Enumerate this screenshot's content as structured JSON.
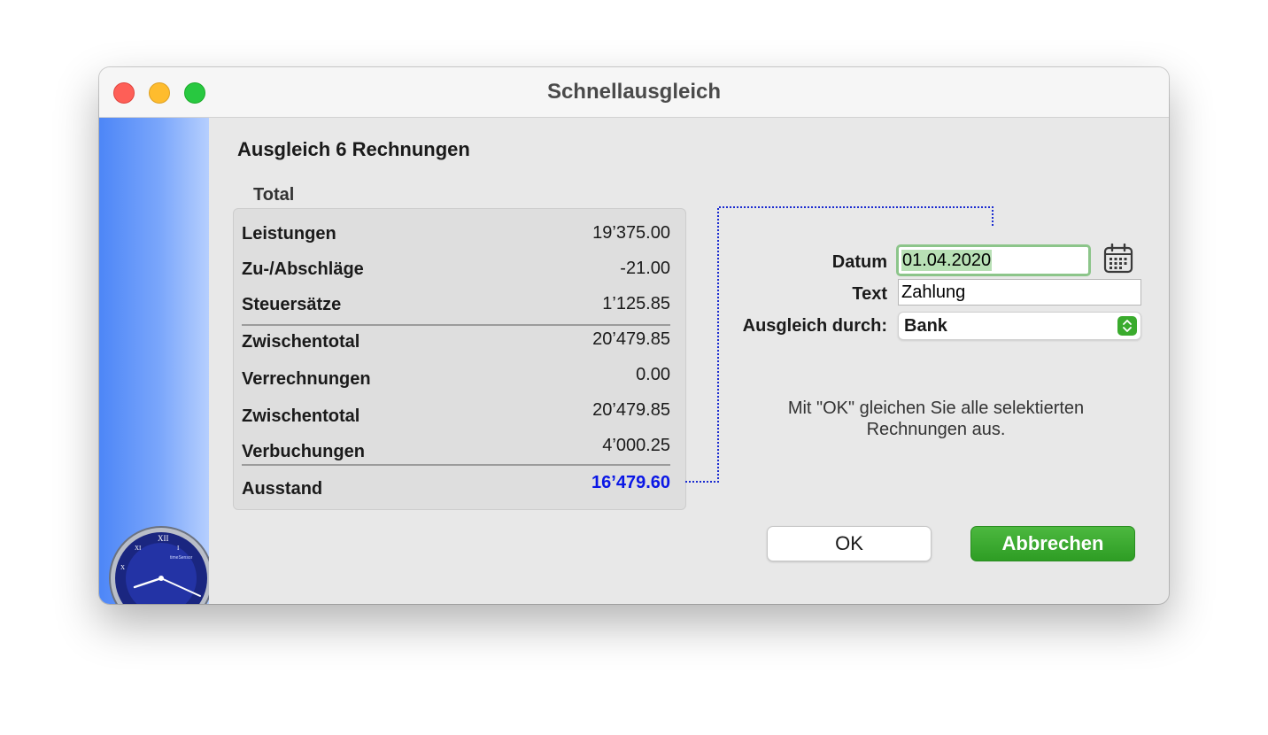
{
  "window": {
    "title": "Schnellausgleich"
  },
  "sidebar": {
    "clock_brand": "timeSensor"
  },
  "heading": "Ausgleich 6 Rechnungen",
  "summary": {
    "title": "Total",
    "rows": [
      {
        "label": "Leistungen",
        "value": "19’375.00"
      },
      {
        "label": "Zu-/Abschläge",
        "value": "-21.00"
      },
      {
        "label": "Steuersätze",
        "value": "1’125.85"
      },
      {
        "label": "Zwischentotal",
        "value": "20’479.85"
      },
      {
        "label": "Verrechnungen",
        "value": "0.00"
      },
      {
        "label": "Zwischentotal",
        "value": "20’479.85"
      },
      {
        "label": "Verbuchungen",
        "value": "4’000.25"
      },
      {
        "label": "Ausstand",
        "value": "16’479.60"
      }
    ]
  },
  "form": {
    "date_label": "Datum",
    "date_value": "01.04.2020",
    "text_label": "Text",
    "text_value": "Zahlung",
    "method_label": "Ausgleich durch:",
    "method_value": "Bank"
  },
  "info_line1": "Mit \"OK\" gleichen Sie alle selektierten",
  "info_line2": "Rechnungen aus.",
  "buttons": {
    "ok": "OK",
    "cancel": "Abbrechen"
  },
  "icons": {
    "date": "calendar-icon",
    "select": "updown-chevron-icon"
  },
  "colors": {
    "accent_green": "#3aab2d",
    "outstanding_blue": "#0a17e6",
    "date_focus": "#8cc58a",
    "sidebar_blue": "#4d86f7"
  }
}
